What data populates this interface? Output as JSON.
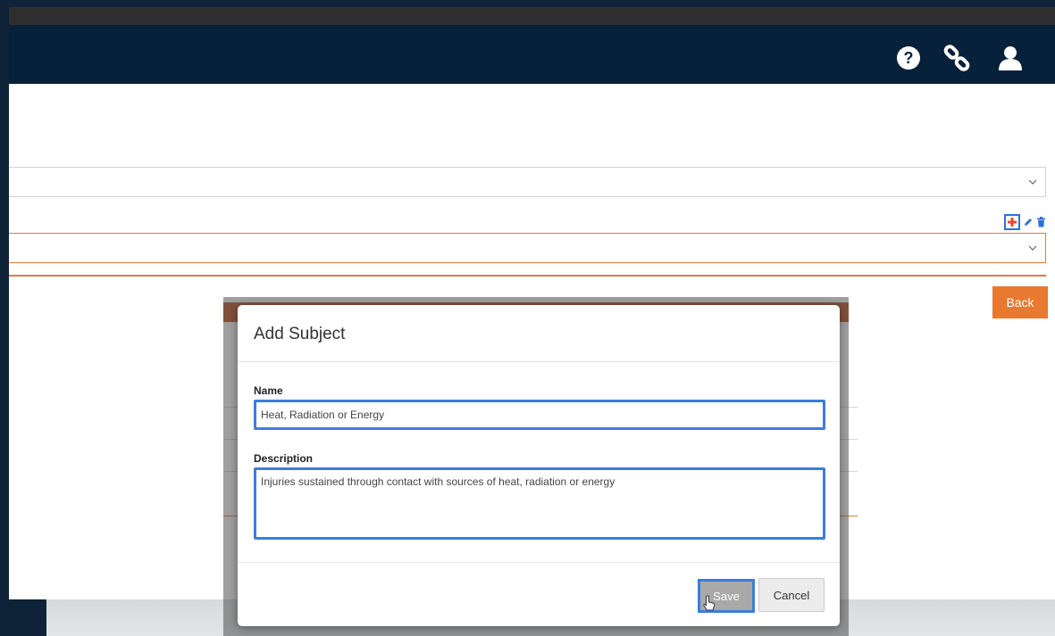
{
  "header": {
    "icons": [
      "help-icon",
      "link-icon",
      "user-icon"
    ]
  },
  "page": {
    "back_label": "Back"
  },
  "modal": {
    "title": "Add Subject",
    "name_label": "Name",
    "name_value": "Heat, Radiation or Energy",
    "description_label": "Description",
    "description_value": "Injuries sustained through contact with sources of heat, radiation or energy",
    "save_label": "Save",
    "cancel_label": "Cancel"
  },
  "colors": {
    "header_bg": "#07213a",
    "accent_orange": "#e8792f",
    "focus_blue": "#3b7ddd"
  }
}
